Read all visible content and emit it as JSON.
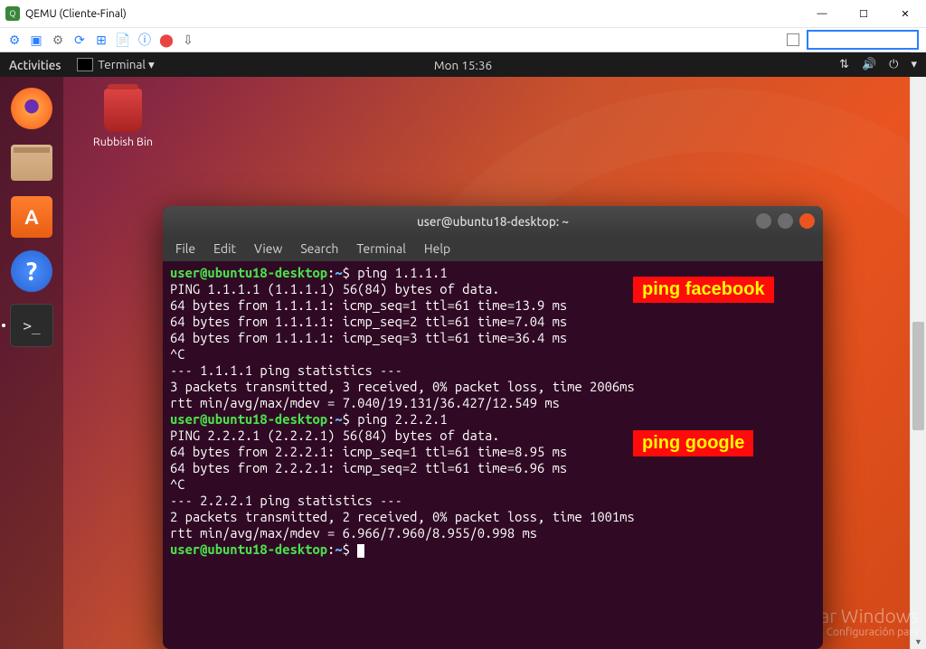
{
  "window": {
    "title": "QEMU (Cliente-Final)"
  },
  "topbar": {
    "activities": "Activities",
    "app": "Terminal ▾",
    "clock": "Mon 15:36"
  },
  "desktop": {
    "rubbish": "Rubbish Bin"
  },
  "terminal": {
    "title": "user@ubuntu18-desktop: ~",
    "menu": [
      "File",
      "Edit",
      "View",
      "Search",
      "Terminal",
      "Help"
    ],
    "prompt_user": "user@ubuntu18-desktop",
    "prompt_path": "~",
    "cmd1": "ping 1.1.1.1",
    "out1": [
      "PING 1.1.1.1 (1.1.1.1) 56(84) bytes of data.",
      "64 bytes from 1.1.1.1: icmp_seq=1 ttl=61 time=13.9 ms",
      "64 bytes from 1.1.1.1: icmp_seq=2 ttl=61 time=7.04 ms",
      "64 bytes from 1.1.1.1: icmp_seq=3 ttl=61 time=36.4 ms",
      "^C",
      "--- 1.1.1.1 ping statistics ---",
      "3 packets transmitted, 3 received, 0% packet loss, time 2006ms",
      "rtt min/avg/max/mdev = 7.040/19.131/36.427/12.549 ms"
    ],
    "cmd2": "ping 2.2.2.1",
    "out2": [
      "PING 2.2.2.1 (2.2.2.1) 56(84) bytes of data.",
      "64 bytes from 2.2.2.1: icmp_seq=1 ttl=61 time=8.95 ms",
      "64 bytes from 2.2.2.1: icmp_seq=2 ttl=61 time=6.96 ms",
      "^C",
      "--- 2.2.2.1 ping statistics ---",
      "2 packets transmitted, 2 received, 0% packet loss, time 1001ms",
      "rtt min/avg/max/mdev = 6.966/7.960/8.955/0.998 ms"
    ]
  },
  "annotations": {
    "a1": "ping facebook",
    "a2": "ping google"
  },
  "watermark": {
    "l1": "Activar Windows",
    "l2": "Ve a Configuración para"
  }
}
